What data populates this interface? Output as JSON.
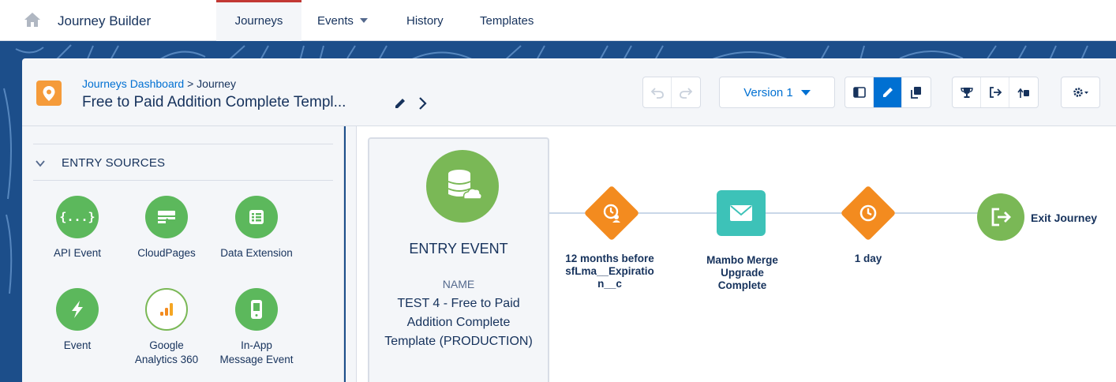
{
  "topnav": {
    "app_title": "Journey Builder",
    "tabs": [
      {
        "label": "Journeys",
        "active": true
      },
      {
        "label": "Events",
        "has_dropdown": true
      },
      {
        "label": "History"
      },
      {
        "label": "Templates"
      }
    ]
  },
  "header": {
    "breadcrumb_link": "Journeys Dashboard",
    "breadcrumb_sep": ">",
    "breadcrumb_current": "Journey",
    "journey_name": "Free to Paid Addition Complete Templ...",
    "version": "Version 1",
    "toolbar_icons": [
      "undo-icon",
      "redo-icon",
      "panel-icon",
      "edit-icon",
      "copy-icon",
      "trophy-icon",
      "exit-icon",
      "reentry-icon",
      "settings-icon"
    ]
  },
  "left_panel": {
    "section_title": "ENTRY SOURCES",
    "sources": [
      {
        "label": "API Event",
        "icon": "api-icon"
      },
      {
        "label": "CloudPages",
        "icon": "cloudpages-icon"
      },
      {
        "label": "Data Extension",
        "icon": "data-extension-icon"
      },
      {
        "label": "Event",
        "icon": "event-icon"
      },
      {
        "label": "Google Analytics 360",
        "label_line1": "Google",
        "label_line2": "Analytics 360",
        "icon": "analytics-icon"
      },
      {
        "label": "In-App Message Event",
        "label_line1": "In-App",
        "label_line2": "Message Event",
        "icon": "in-app-icon"
      }
    ]
  },
  "canvas": {
    "entry": {
      "title": "ENTRY EVENT",
      "name_label": "NAME",
      "name_value": "TEST 4 - Free to Paid Addition Complete Template (PRODUCTION)"
    },
    "nodes": [
      {
        "type": "wait",
        "label_line1": "12 months before",
        "label_line2": "sfLma__Expiratio",
        "label_line3": "n__c"
      },
      {
        "type": "email",
        "label_line1": "Mambo Merge",
        "label_line2": "Upgrade",
        "label_line3": "Complete"
      },
      {
        "type": "wait",
        "label_line1": "1 day"
      },
      {
        "type": "exit",
        "label_line1": "Exit Journey"
      }
    ]
  },
  "colors": {
    "brand_blue": "#0070d2",
    "active_tab_border": "#c23934",
    "green": "#7ab856",
    "orange": "#f38b1f",
    "teal": "#3dc2b8",
    "banner": "#1c4e8a"
  }
}
